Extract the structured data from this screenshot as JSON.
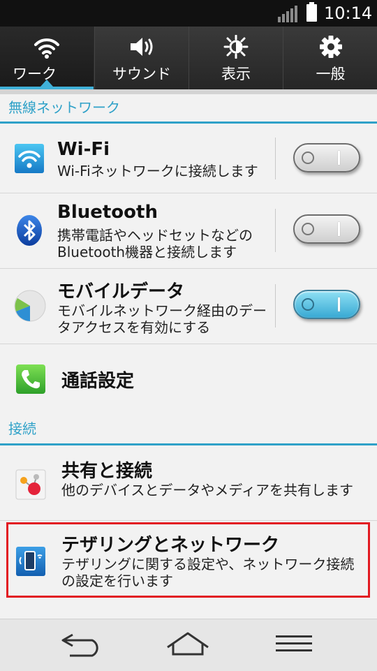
{
  "status_bar": {
    "time": "10:14"
  },
  "tabs": [
    {
      "label": "ワーク",
      "icon": "wifi-icon",
      "active": true
    },
    {
      "label": "サウンド",
      "icon": "speaker-icon",
      "active": false
    },
    {
      "label": "表示",
      "icon": "brightness-icon",
      "active": false
    },
    {
      "label": "一般",
      "icon": "gear-icon",
      "active": false
    }
  ],
  "sections": {
    "wireless": "無線ネットワーク",
    "connection": "接続"
  },
  "items": {
    "wifi": {
      "title": "Wi-Fi",
      "desc": "Wi-Fiネットワークに接続します",
      "toggle": "off"
    },
    "bluetooth": {
      "title": "Bluetooth",
      "desc": "携帯電話やヘッドセットなどのBluetooth機器と接続します",
      "toggle": "off"
    },
    "mobile_data": {
      "title": "モバイルデータ",
      "desc": "モバイルネットワーク経由のデータアクセスを有効にする",
      "toggle": "on"
    },
    "call": {
      "title": "通話設定"
    },
    "share": {
      "title": "共有と接続",
      "desc": "他のデバイスとデータやメディアを共有します"
    },
    "tethering": {
      "title": "テザリングとネットワーク",
      "desc": "テザリングに関する設定や、ネットワーク接続の設定を行います"
    }
  },
  "colors": {
    "accent": "#2fa1c8",
    "highlight": "#e21a22",
    "toggle_on": "#38a9d3"
  },
  "nav_bar": [
    "back-icon",
    "home-icon",
    "menu-icon"
  ]
}
